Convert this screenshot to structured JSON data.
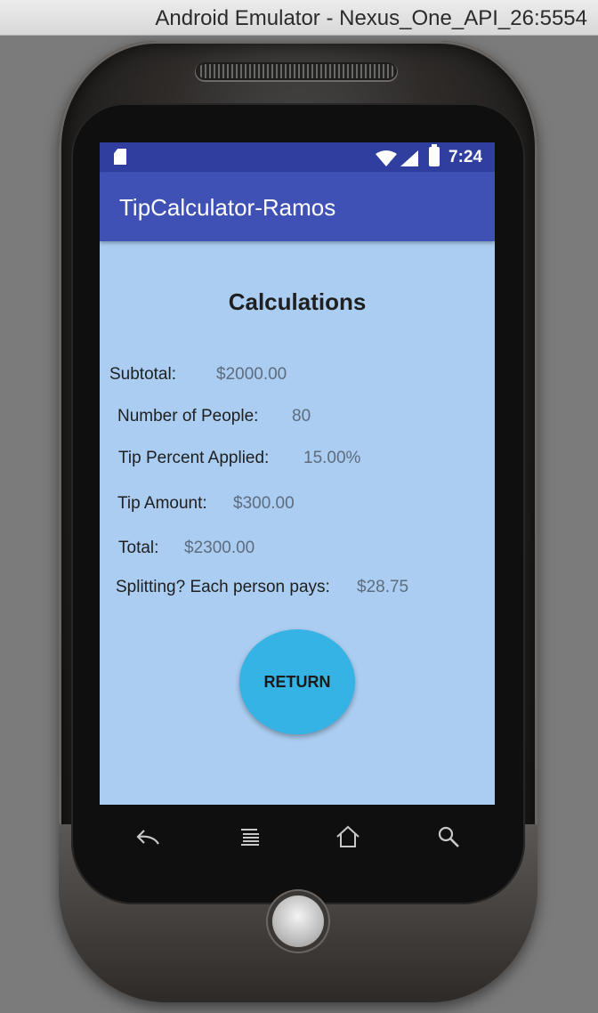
{
  "window": {
    "title": "Android Emulator - Nexus_One_API_26:5554"
  },
  "statusbar": {
    "time": "7:24",
    "icons": [
      "sd-card-icon",
      "wifi-icon",
      "signal-icon",
      "battery-icon"
    ]
  },
  "app": {
    "title": "TipCalculator-Ramos",
    "toolbar_color": "#3f51b5",
    "statusbar_color": "#303f9f",
    "background_color": "#aacdf1"
  },
  "calc": {
    "heading": "Calculations",
    "subtotal_label": "Subtotal:",
    "subtotal_value": "$2000.00",
    "people_label": "Number of People:",
    "people_value": "80",
    "tip_percent_label": "Tip Percent Applied:",
    "tip_percent_value": "15.00%",
    "tip_amount_label": "Tip Amount:",
    "tip_amount_value": "$300.00",
    "total_label": "Total:",
    "total_value": "$2300.00",
    "split_label": "Splitting? Each person pays:",
    "split_value": "$28.75"
  },
  "return_button": {
    "label": "RETURN",
    "color": "#35b3e5"
  },
  "navbar": {
    "buttons": [
      "back-icon",
      "menu-icon",
      "home-icon",
      "search-icon"
    ]
  }
}
